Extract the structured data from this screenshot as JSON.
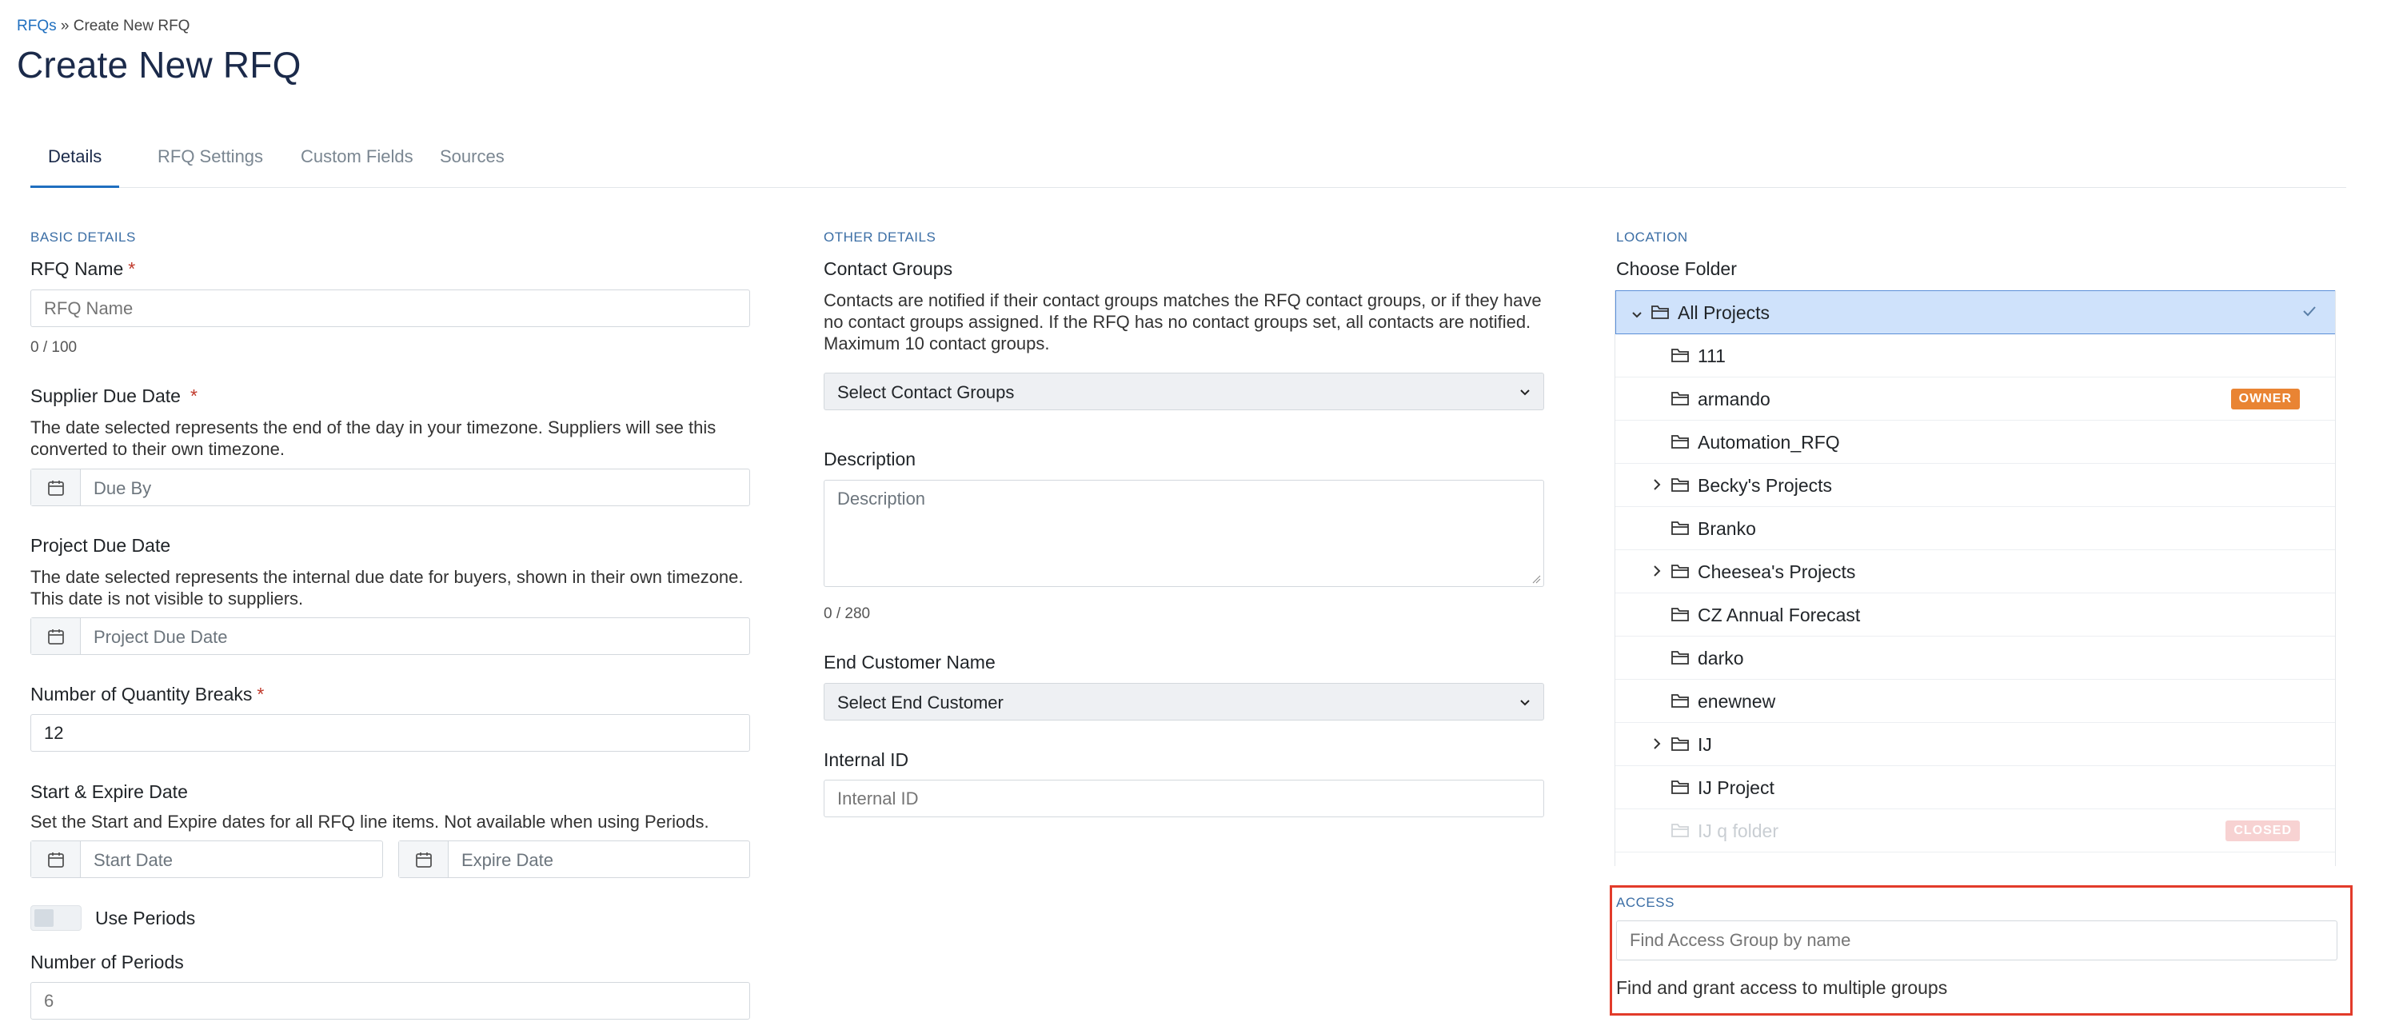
{
  "breadcrumb": {
    "link": "RFQs",
    "separator": "»",
    "current": "Create New RFQ"
  },
  "page_title": "Create New RFQ",
  "tabs": [
    {
      "label": "Details",
      "active": true
    },
    {
      "label": "RFQ Settings",
      "active": false
    },
    {
      "label": "Custom Fields",
      "active": false
    },
    {
      "label": "Sources",
      "active": false
    }
  ],
  "basic": {
    "section": "BASIC DETAILS",
    "rfq_name_label": "RFQ Name",
    "rfq_name_placeholder": "RFQ Name",
    "rfq_name_counter": "0 / 100",
    "supplier_due_label": "Supplier Due Date",
    "supplier_due_help": "The date selected represents the end of the day in your timezone. Suppliers will see this converted to their own timezone.",
    "supplier_due_placeholder": "Due By",
    "project_due_label": "Project Due Date",
    "project_due_help": "The date selected represents the internal due date for buyers, shown in their own timezone. This date is not visible to suppliers.",
    "project_due_placeholder": "Project Due Date",
    "qty_breaks_label": "Number of Quantity Breaks",
    "qty_breaks_value": "12",
    "start_expire_label": "Start & Expire Date",
    "start_expire_help": "Set the Start and Expire dates for all RFQ line items. Not available when using Periods.",
    "start_placeholder": "Start Date",
    "expire_placeholder": "Expire Date",
    "use_periods_label": "Use Periods",
    "num_periods_label": "Number of Periods",
    "num_periods_placeholder": "6",
    "required_mark": "*"
  },
  "other": {
    "section": "OTHER DETAILS",
    "contact_groups_label": "Contact Groups",
    "contact_groups_help": "Contacts are notified if their contact groups matches the RFQ contact groups, or if they have no contact groups assigned. If the RFQ has no contact groups set, all contacts are notified. Maximum 10 contact groups.",
    "contact_groups_select": "Select Contact Groups",
    "description_label": "Description",
    "description_placeholder": "Description",
    "description_counter": "0 / 280",
    "end_customer_label": "End Customer Name",
    "end_customer_select": "Select End Customer",
    "internal_id_label": "Internal ID",
    "internal_id_placeholder": "Internal ID"
  },
  "location": {
    "section": "LOCATION",
    "choose_folder_label": "Choose Folder",
    "folders": [
      {
        "name": "All Projects",
        "level": 0,
        "expandable": true,
        "expanded": true,
        "selected": true,
        "badge": ""
      },
      {
        "name": "111",
        "level": 1,
        "expandable": false,
        "badge": ""
      },
      {
        "name": "armando",
        "level": 1,
        "expandable": false,
        "badge": "OWNER"
      },
      {
        "name": "Automation_RFQ",
        "level": 1,
        "expandable": false,
        "badge": ""
      },
      {
        "name": "Becky's Projects",
        "level": 1,
        "expandable": true,
        "badge": ""
      },
      {
        "name": "Branko",
        "level": 1,
        "expandable": false,
        "badge": ""
      },
      {
        "name": "Cheesea's Projects",
        "level": 1,
        "expandable": true,
        "badge": ""
      },
      {
        "name": "CZ Annual Forecast",
        "level": 1,
        "expandable": false,
        "badge": ""
      },
      {
        "name": "darko",
        "level": 1,
        "expandable": false,
        "badge": ""
      },
      {
        "name": "enewnew",
        "level": 1,
        "expandable": false,
        "badge": ""
      },
      {
        "name": "IJ",
        "level": 1,
        "expandable": true,
        "badge": ""
      },
      {
        "name": "IJ Project",
        "level": 1,
        "expandable": false,
        "badge": ""
      },
      {
        "name": "IJ q folder",
        "level": 1,
        "expandable": false,
        "badge": "CLOSED",
        "muted": true
      }
    ]
  },
  "access": {
    "section": "ACCESS",
    "search_placeholder": "Find Access Group by name",
    "help": "Find and grant access to multiple groups"
  },
  "colors": {
    "accent": "#1f6fbf",
    "selected_bg": "#cfe2fb",
    "owner_badge": "#e98433",
    "highlight_border": "#e23b2a"
  }
}
